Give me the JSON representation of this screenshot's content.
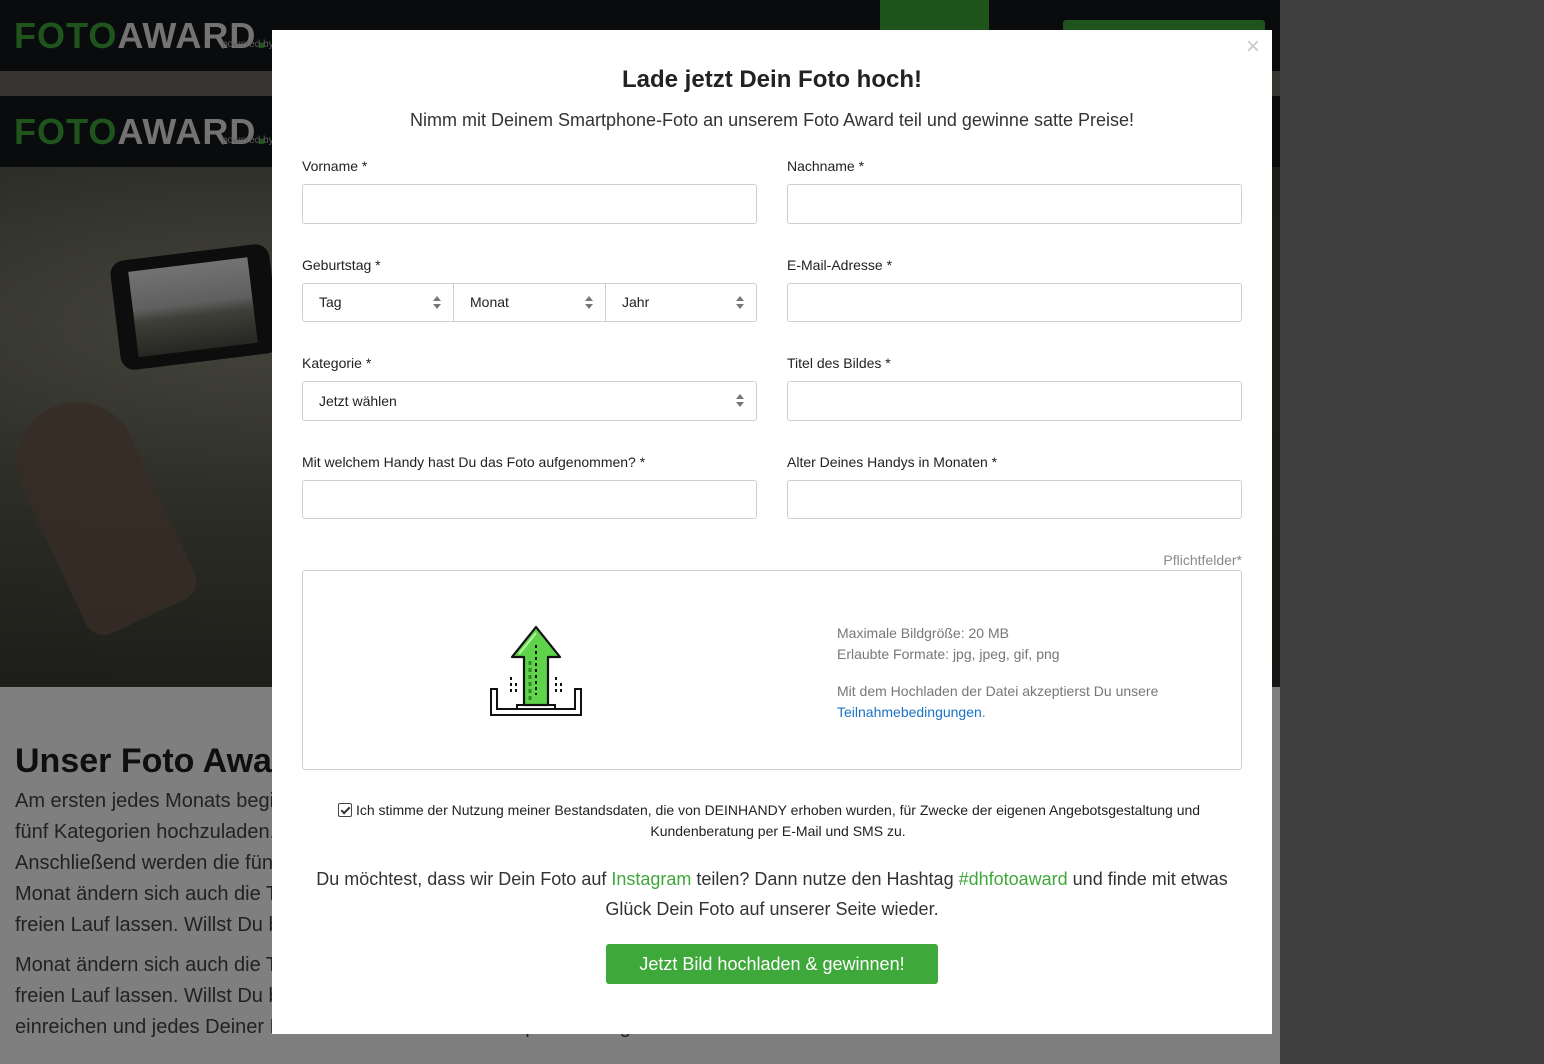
{
  "background": {
    "logo_foto": "FOTO",
    "logo_award": "AWARD",
    "logo_dot": ".",
    "logo_powered": "powered by",
    "article_title": "Unser Foto Awar",
    "article_lines": [
      "Am ersten jedes Monats begi",
      "fünf Kategorien hochzuladen.",
      "Anschließend werden die fünf",
      "Monat ändern sich auch die T",
      "freien Lauf lassen. Willst Du b"
    ],
    "article_lines_2": [
      "Monat ändern sich auch die T",
      "freien Lauf lassen. Willst Du b",
      "einreichen und jedes Deiner Bilder muss mit einem Smartphone fotografiert werden sein."
    ]
  },
  "modal": {
    "close_symbol": "×",
    "title": "Lade jetzt Dein Foto hoch!",
    "subtitle": "Nimm mit Deinem Smartphone-Foto an unserem Foto Award teil und gewinne satte Preise!",
    "fields": {
      "vorname_label": "Vorname *",
      "nachname_label": "Nachname *",
      "geburtstag_label": "Geburtstag *",
      "email_label": "E-Mail-Adresse *",
      "kategorie_label": "Kategorie *",
      "titel_label": "Titel des Bildes *",
      "handy_label": "Mit welchem Handy hast Du das Foto aufgenommen? *",
      "alter_label": "Alter Deines Handys in Monaten *",
      "tag_value": "Tag",
      "monat_value": "Monat",
      "jahr_value": "Jahr",
      "kategorie_value": "Jetzt wählen"
    },
    "pflichtfelder": "Pflichtfelder*",
    "upload": {
      "max_size": "Maximale Bildgröße: 20 MB",
      "formats": "Erlaubte Formate: jpg, jpeg, gif, png",
      "terms_text": "Mit dem Hochladen der Datei akzeptierst Du unsere",
      "terms_link": "Teilnahmebedingungen",
      "terms_end": ".",
      "icon": "upload-arrow-icon"
    },
    "consent_text": "Ich stimme der Nutzung meiner Bestandsdaten, die von DEINHANDY erhoben wurden, für Zwecke der eigenen Angebotsgestaltung und Kundenberatung per E-Mail und SMS zu.",
    "consent_checked": true,
    "share": {
      "part1": "Du möchtest, dass wir Dein Foto auf ",
      "instagram": "Instagram",
      "part2": " teilen? Dann nutze den Hashtag ",
      "hashtag": "#dhfotoaward",
      "part3": " und finde mit etwas Glück Dein Foto auf unserer Seite wieder."
    },
    "submit_label": "Jetzt Bild hochladen & gewinnen!"
  },
  "colors": {
    "accent": "#3ea83a",
    "link": "#1a73c4",
    "header_bg": "#15161b"
  }
}
